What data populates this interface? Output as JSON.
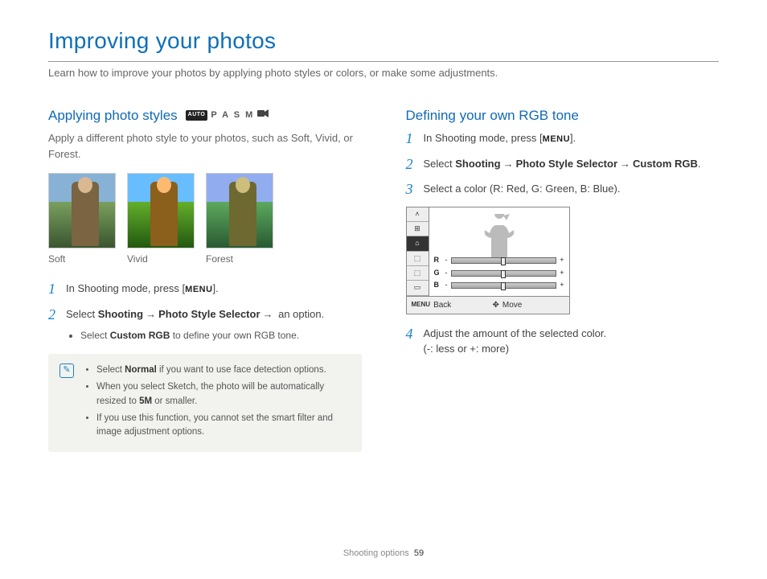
{
  "title": "Improving your photos",
  "intro": "Learn how to improve your photos by applying photo styles or colors, or make some adjustments.",
  "left": {
    "heading": "Applying photo styles",
    "modes_auto": "AUTO",
    "modes_pasms": "P A S M",
    "desc": "Apply a different photo style to your photos, such as Soft, Vivid, or Forest.",
    "thumbs": {
      "a": "Soft",
      "b": "Vivid",
      "c": "Forest"
    },
    "steps": {
      "s1_a": "In Shooting mode, press [",
      "s1_menu": "MENU",
      "s1_b": "].",
      "s2_a": "Select ",
      "s2_b": "Shooting",
      "s2_c": "Photo Style Selector",
      "s2_d": " an option.",
      "bullet1_a": "Select ",
      "bullet1_b": "Custom RGB",
      "bullet1_c": " to define your own RGB tone."
    },
    "note": {
      "n1_a": "Select ",
      "n1_b": "Normal",
      "n1_c": " if you want to use face detection options.",
      "n2_a": "When you select Sketch, the photo will be automatically resized to ",
      "n2_icon": "5M",
      "n2_b": " or smaller.",
      "n3": "If you use this function, you cannot set the smart filter and image adjustment options."
    }
  },
  "right": {
    "heading": "Defining your own RGB tone",
    "steps": {
      "s1_a": "In Shooting mode, press [",
      "s1_menu": "MENU",
      "s1_b": "].",
      "s2_a": "Select ",
      "s2_b": "Shooting",
      "s2_c": "Photo Style Selector",
      "s2_d": "Custom RGB",
      "s2_e": ".",
      "s3": "Select a color (R: Red, G: Green, B: Blue).",
      "s4_a": "Adjust the amount of the selected color.",
      "s4_b": "(-: less or +: more)"
    },
    "diagram": {
      "r": "R",
      "g": "G",
      "b": "B",
      "back_menu": "MENU",
      "back": "Back",
      "move": "Move"
    }
  },
  "footer": {
    "section": "Shooting options",
    "page": "59"
  }
}
